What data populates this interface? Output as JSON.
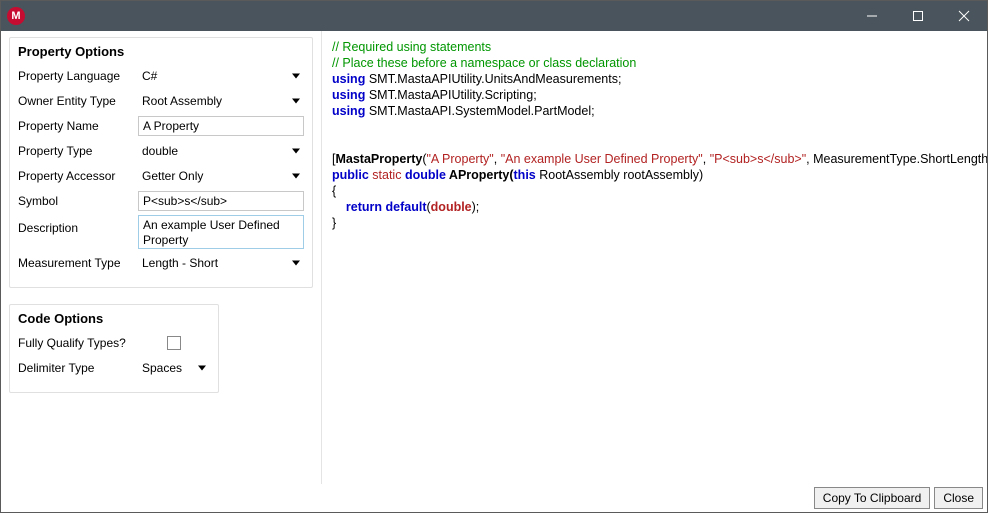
{
  "window": {
    "title": "",
    "icon_letter": "M"
  },
  "propertyOptions": {
    "heading": "Property Options",
    "fields": {
      "language": {
        "label": "Property Language",
        "value": "C#"
      },
      "ownerEntityType": {
        "label": "Owner Entity Type",
        "value": "Root Assembly"
      },
      "propertyName": {
        "label": "Property Name",
        "value": "A Property"
      },
      "propertyType": {
        "label": "Property Type",
        "value": "double"
      },
      "propertyAccessor": {
        "label": "Property Accessor",
        "value": "Getter Only"
      },
      "symbol": {
        "label": "Symbol",
        "value": "P<sub>s</sub>"
      },
      "description": {
        "label": "Description",
        "value": "An example User Defined Property"
      },
      "measurementType": {
        "label": "Measurement Type",
        "value": "Length - Short"
      }
    }
  },
  "codeOptions": {
    "heading": "Code Options",
    "fullyQualify": {
      "label": "Fully Qualify Types?",
      "checked": false
    },
    "delimiterType": {
      "label": "Delimiter Type",
      "value": "Spaces"
    }
  },
  "code": {
    "comment1": "// Required using statements",
    "comment2": "// Place these before a namespace or class declaration",
    "using_kw": "using",
    "using1": " SMT.MastaAPIUtility.UnitsAndMeasurements;",
    "using2": " SMT.MastaAPIUtility.Scripting;",
    "using3": " SMT.MastaAPI.SystemModel.PartModel;",
    "attr_open": "[",
    "attr_name": "MastaProperty",
    "attr_paren_open": "(",
    "attr_str1": "\"A Property\"",
    "attr_sep1": ", ",
    "attr_str2": "\"An example User Defined Property\"",
    "attr_sep2": ", ",
    "attr_str3": "\"P<sub>s</sub>\"",
    "attr_sep3": ", MeasurementType.ShortLength)]",
    "sig_public": "public",
    "sig_static": " static ",
    "sig_double": "double",
    "sig_name": " AProperty(",
    "sig_this": "this",
    "sig_rest": " RootAssembly rootAssembly)",
    "brace_open": "{",
    "ret_indent": "    ",
    "ret_return": "return",
    "ret_sp": " ",
    "ret_default": "default",
    "ret_po": "(",
    "ret_double": "double",
    "ret_pc": ");",
    "brace_close": "}"
  },
  "buttons": {
    "copy": "Copy To Clipboard",
    "close": "Close"
  }
}
